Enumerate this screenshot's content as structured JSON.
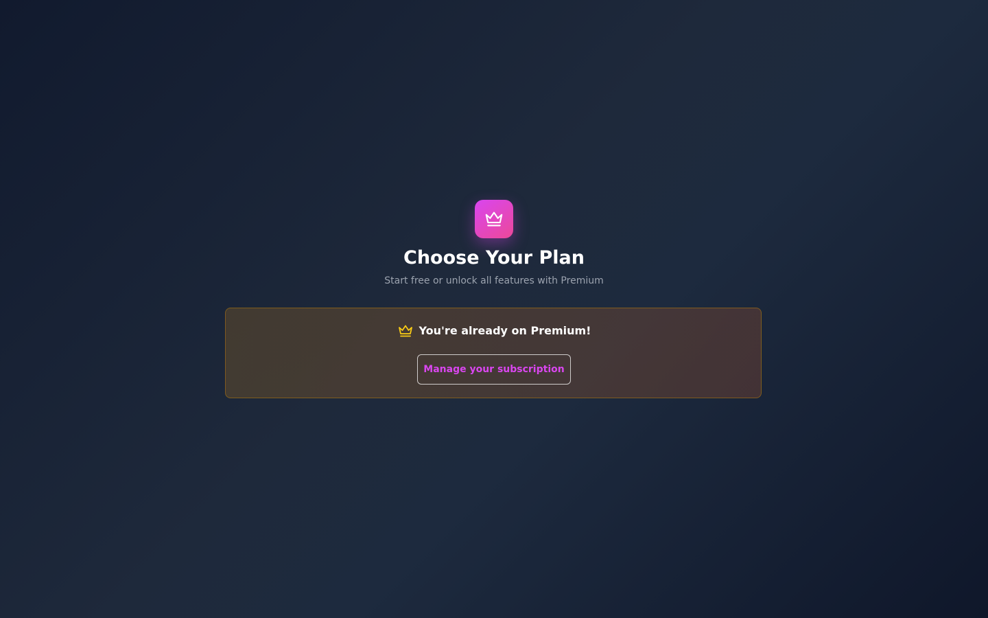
{
  "header": {
    "logo_icon": "crown-icon",
    "title": "Choose Your Plan",
    "subtitle": "Start free or unlock all features with Premium"
  },
  "premium_notice": {
    "icon": "crown-icon",
    "heading": "You're already on Premium!",
    "manage_button_label": "Manage your subscription"
  },
  "colors": {
    "accent": "#d946ef",
    "accent_pink": "#ec4899",
    "gold": "#facc15",
    "background": "#1e293b"
  }
}
